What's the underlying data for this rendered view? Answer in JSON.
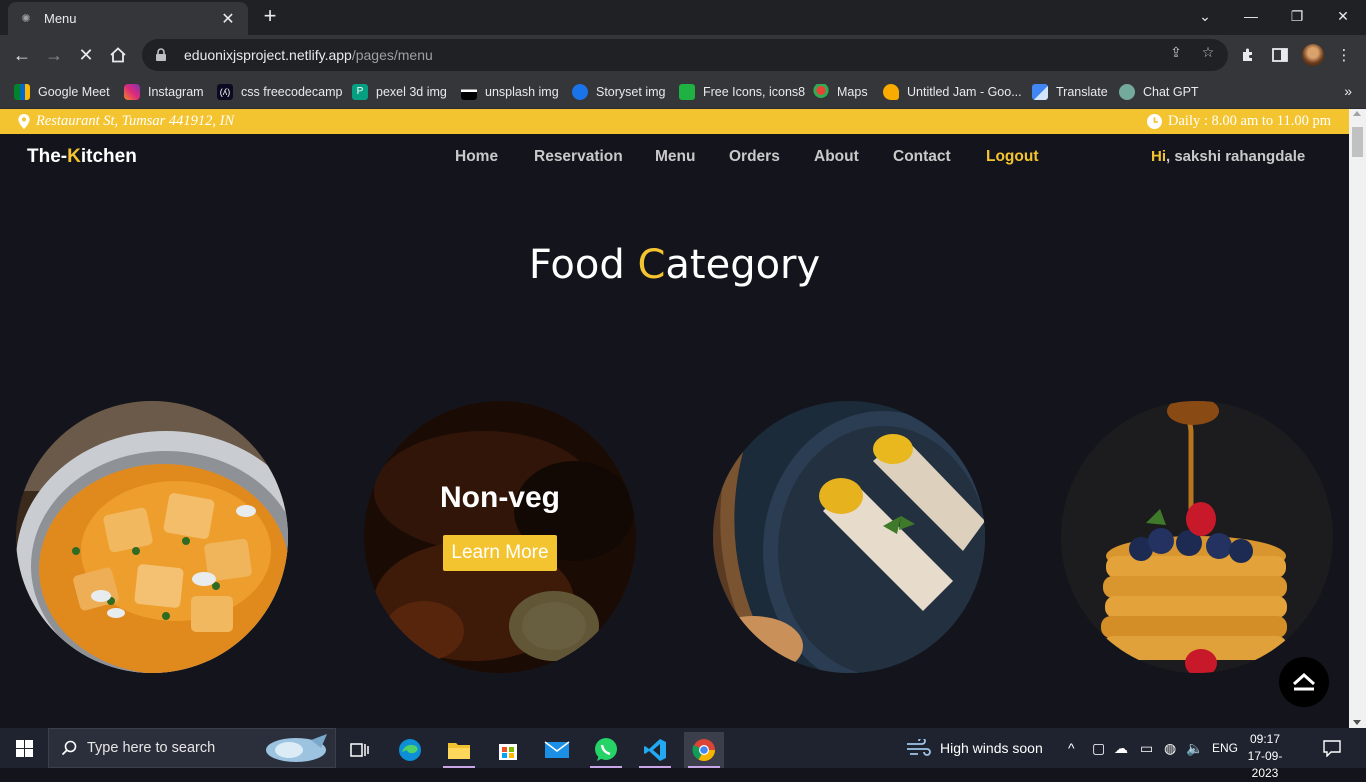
{
  "browser": {
    "tab_title": "Menu",
    "url_domain": "eduonixjsproject.netlify.app",
    "url_path": "/pages/menu",
    "bookmarks": [
      {
        "label": "Google Meet",
        "color": "#1e8e3e"
      },
      {
        "label": "Instagram",
        "color": "#d6249f"
      },
      {
        "label": "css freecodecamp",
        "color": "#0a0a23"
      },
      {
        "label": "pexel 3d img",
        "color": "#05a081"
      },
      {
        "label": "unsplash img",
        "color": "#111111"
      },
      {
        "label": "Storyset img",
        "color": "#1a73e8"
      },
      {
        "label": "Free Icons, icons8",
        "color": "#1fb141"
      },
      {
        "label": "Maps",
        "color": "#34a853"
      },
      {
        "label": "Untitled Jam - Goo...",
        "color": "#f9ab00"
      },
      {
        "label": "Translate",
        "color": "#4285f4"
      },
      {
        "label": "Chat GPT",
        "color": "#74aa9c"
      }
    ]
  },
  "site": {
    "address": "Restaurant St, Tumsar 441912, IN",
    "hours": "Daily : 8.00 am to 11.00 pm",
    "logo_pre": "The-",
    "logo_k": "K",
    "logo_post": "itchen",
    "nav": [
      "Home",
      "Reservation",
      "Menu",
      "Orders",
      "About",
      "Contact",
      "Logout"
    ],
    "greeting_hi": "Hi",
    "greeting_name": ", sakshi rahangdale",
    "section_title_pre": "Food ",
    "section_title_c": "C",
    "section_title_post": "ategory",
    "categories": [
      {
        "name": "Non-veg",
        "button": "Learn More"
      }
    ],
    "accent_color": "#f4c430"
  },
  "taskbar": {
    "search_placeholder": "Type here to search",
    "weather": "High winds soon",
    "language": "ENG",
    "time": "09:17",
    "date": "17-09-2023"
  }
}
